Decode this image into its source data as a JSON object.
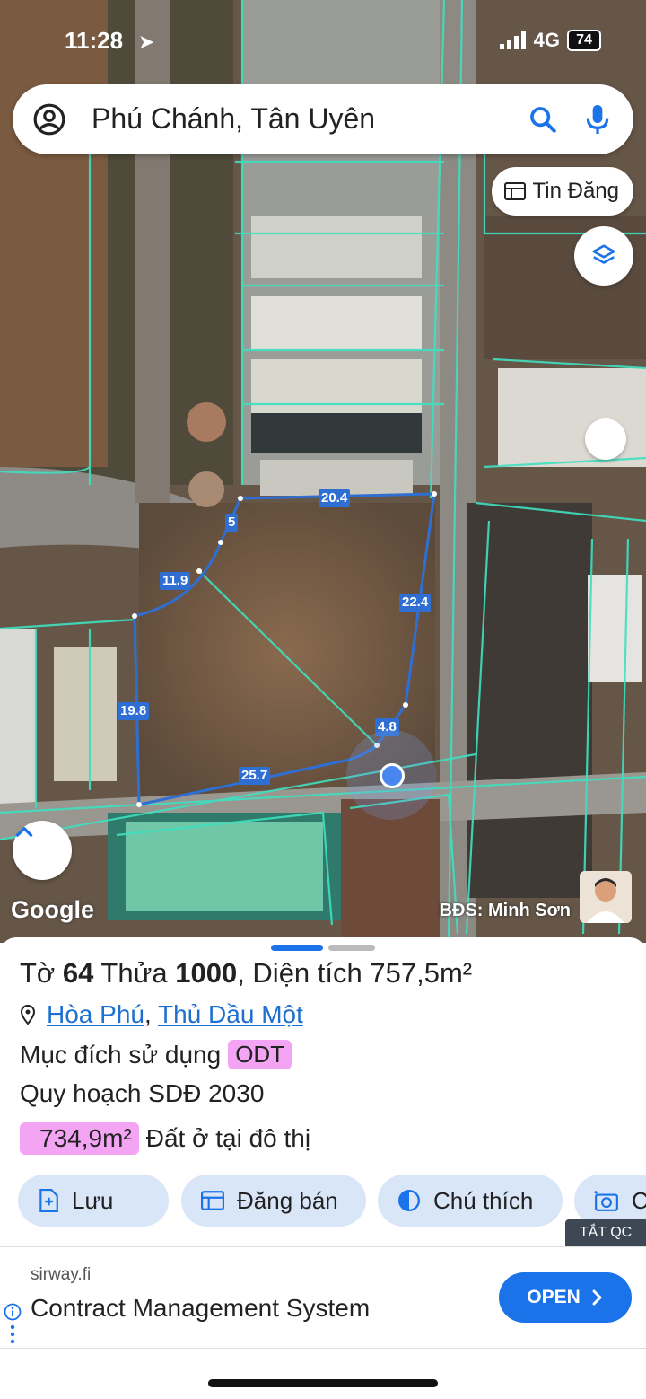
{
  "status_bar": {
    "time": "11:28",
    "network": "4G",
    "battery": "74"
  },
  "search": {
    "text": "Phú Chánh, Tân Uyên"
  },
  "tin_dang_button": {
    "label": "Tin Đăng"
  },
  "map": {
    "edge_labels": [
      "20.4",
      "5",
      "11.9",
      "22.4",
      "19.8",
      "4.8",
      "25.7"
    ],
    "attribution": "Google",
    "credit": "BĐS: Minh Sơn"
  },
  "parcel": {
    "to_label": "Tờ ",
    "to_value": "64",
    "thua_label": " Thửa ",
    "thua_value": "1000",
    "area_label": ", Diện tích ",
    "area_value": "757,5m²",
    "place_1": "Hòa Phú",
    "separator": ",",
    "place_2": "Thủ Dầu Một",
    "purpose_label": "Mục đích sử dụng",
    "purpose_code": "ODT",
    "planning": "Quy hoạch SDĐ 2030",
    "planning_area": "734,9m²",
    "planning_use": "Đất ở tại đô thị"
  },
  "actions": [
    {
      "label": "Lưu",
      "icon": "save-plus-icon"
    },
    {
      "label": "Đăng bán",
      "icon": "calendar-icon"
    },
    {
      "label": "Chú thích",
      "icon": "legend-half-circle-icon"
    },
    {
      "label": "C",
      "icon": "camera-icon"
    }
  ],
  "ad_close": "TẮT QC",
  "ad": {
    "domain": "sirway.fi",
    "title": "Contract Management System",
    "cta": "OPEN"
  },
  "colors": {
    "accent": "#1a73e8",
    "parcel_line": "#2f6fd4",
    "cadastral": "#3fe0c0",
    "tag": "#f3a5f3",
    "chip": "#d9e6f7"
  }
}
